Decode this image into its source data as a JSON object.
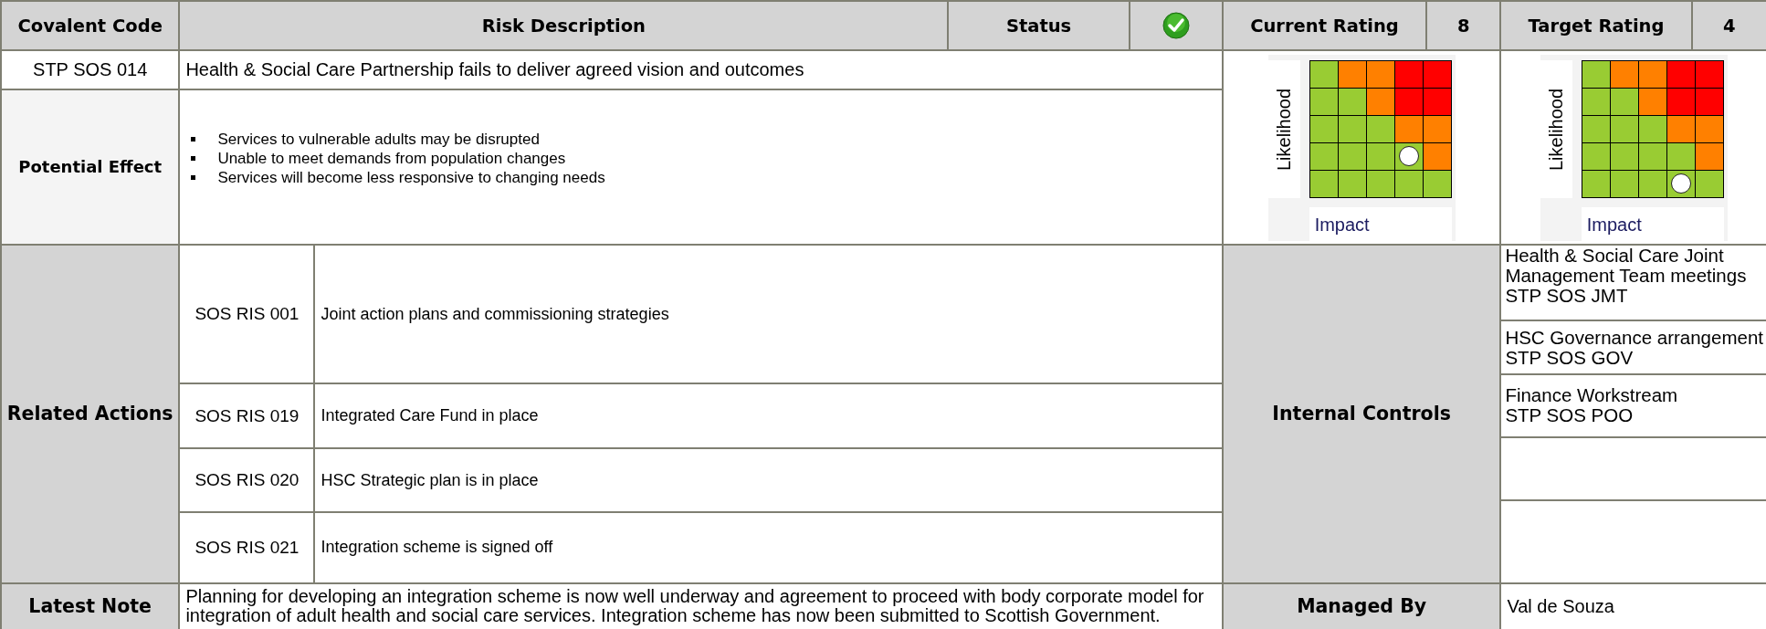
{
  "header": {
    "code_label": "Covalent Code",
    "description_label": "Risk Description",
    "status_label": "Status",
    "status_complete": true,
    "current_rating_label": "Current Rating",
    "current_rating": "8",
    "target_rating_label": "Target Rating",
    "target_rating": "4"
  },
  "risk": {
    "code": "STP SOS 014",
    "description": "Health & Social Care Partnership fails to deliver agreed vision and outcomes"
  },
  "potential_effect": {
    "label": "Potential Effect",
    "items": [
      "Services to vulnerable adults may be disrupted",
      "Unable to meet demands from population changes",
      "Services will become less responsive to changing needs"
    ]
  },
  "heat_maps": [
    {
      "y_label": "Likelihood",
      "x_label": "Impact",
      "rows": [
        [
          {
            "color": "#99cc33",
            "marked": false
          },
          {
            "color": "#ff8000",
            "marked": false
          },
          {
            "color": "#ff8000",
            "marked": false
          },
          {
            "color": "#ff0000",
            "marked": false
          },
          {
            "color": "#ff0000",
            "marked": false
          }
        ],
        [
          {
            "color": "#99cc33",
            "marked": false
          },
          {
            "color": "#99cc33",
            "marked": false
          },
          {
            "color": "#ff8000",
            "marked": false
          },
          {
            "color": "#ff0000",
            "marked": false
          },
          {
            "color": "#ff0000",
            "marked": false
          }
        ],
        [
          {
            "color": "#99cc33",
            "marked": false
          },
          {
            "color": "#99cc33",
            "marked": false
          },
          {
            "color": "#99cc33",
            "marked": false
          },
          {
            "color": "#ff8000",
            "marked": false
          },
          {
            "color": "#ff8000",
            "marked": false
          }
        ],
        [
          {
            "color": "#99cc33",
            "marked": false
          },
          {
            "color": "#99cc33",
            "marked": false
          },
          {
            "color": "#99cc33",
            "marked": false
          },
          {
            "color": "#99cc33",
            "marked": true
          },
          {
            "color": "#ff8000",
            "marked": false
          }
        ],
        [
          {
            "color": "#99cc33",
            "marked": false
          },
          {
            "color": "#99cc33",
            "marked": false
          },
          {
            "color": "#99cc33",
            "marked": false
          },
          {
            "color": "#99cc33",
            "marked": false
          },
          {
            "color": "#99cc33",
            "marked": false
          }
        ]
      ]
    },
    {
      "y_label": "Likelihood",
      "x_label": "Impact",
      "rows": [
        [
          {
            "color": "#99cc33",
            "marked": false
          },
          {
            "color": "#ff8000",
            "marked": false
          },
          {
            "color": "#ff8000",
            "marked": false
          },
          {
            "color": "#ff0000",
            "marked": false
          },
          {
            "color": "#ff0000",
            "marked": false
          }
        ],
        [
          {
            "color": "#99cc33",
            "marked": false
          },
          {
            "color": "#99cc33",
            "marked": false
          },
          {
            "color": "#ff8000",
            "marked": false
          },
          {
            "color": "#ff0000",
            "marked": false
          },
          {
            "color": "#ff0000",
            "marked": false
          }
        ],
        [
          {
            "color": "#99cc33",
            "marked": false
          },
          {
            "color": "#99cc33",
            "marked": false
          },
          {
            "color": "#99cc33",
            "marked": false
          },
          {
            "color": "#ff8000",
            "marked": false
          },
          {
            "color": "#ff8000",
            "marked": false
          }
        ],
        [
          {
            "color": "#99cc33",
            "marked": false
          },
          {
            "color": "#99cc33",
            "marked": false
          },
          {
            "color": "#99cc33",
            "marked": false
          },
          {
            "color": "#99cc33",
            "marked": false
          },
          {
            "color": "#ff8000",
            "marked": false
          }
        ],
        [
          {
            "color": "#99cc33",
            "marked": false
          },
          {
            "color": "#99cc33",
            "marked": false
          },
          {
            "color": "#99cc33",
            "marked": false
          },
          {
            "color": "#99cc33",
            "marked": true
          },
          {
            "color": "#99cc33",
            "marked": false
          }
        ]
      ]
    }
  ],
  "related_actions": {
    "label": "Related Actions",
    "items": [
      {
        "code": "SOS RIS 001",
        "title": "Joint action plans and commissioning strategies"
      },
      {
        "code": "SOS RIS 019",
        "title": "Integrated Care Fund in place"
      },
      {
        "code": "SOS RIS 020",
        "title": "HSC Strategic plan is in place"
      },
      {
        "code": "SOS RIS 021",
        "title": "Integration scheme is signed off"
      }
    ]
  },
  "internal_controls": {
    "label": "Internal Controls",
    "items": [
      {
        "kind": "entry",
        "lines": [
          "Health & Social Care Joint",
          "Management Team meetings",
          "STP SOS JMT"
        ]
      },
      {
        "kind": "entry",
        "lines": [
          "HSC Governance arrangement",
          "STP SOS GOV"
        ]
      },
      {
        "kind": "entry",
        "lines": [
          "Finance Workstream",
          "STP SOS POO"
        ]
      },
      {
        "kind": "blank"
      },
      {
        "kind": "blank"
      }
    ]
  },
  "latest_note": {
    "label": "Latest Note",
    "text": "Planning for developing an integration scheme is now well underway and agreement to proceed with body corporate model for integration of adult health and social care services.  Integration scheme has now been submitted to Scottish Government."
  },
  "managed_by": {
    "label": "Managed By",
    "name": "Val de Souza"
  }
}
